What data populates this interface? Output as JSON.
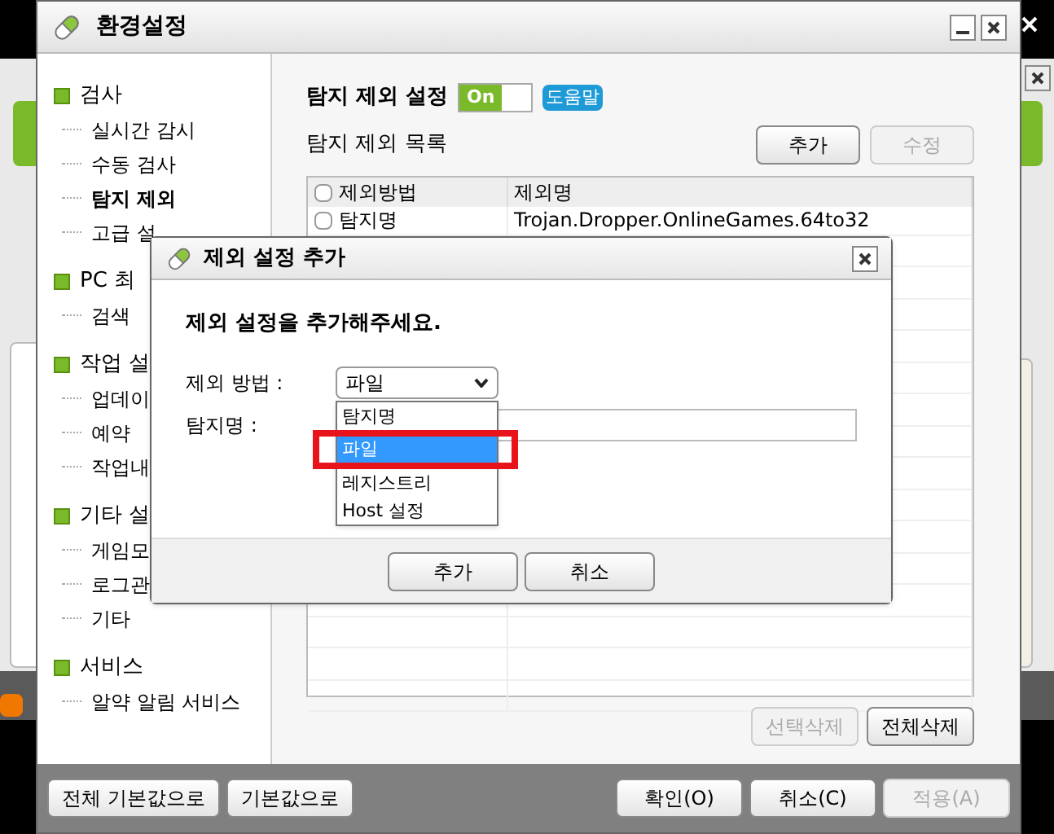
{
  "window": {
    "title": "환경설정"
  },
  "sidebar": {
    "groups": [
      {
        "label": "검사",
        "children": [
          {
            "label": "실시간 감시",
            "selected": false
          },
          {
            "label": "수동 검사",
            "selected": false
          },
          {
            "label": "탐지 제외",
            "selected": true
          },
          {
            "label": "고급 설",
            "selected": false
          }
        ]
      },
      {
        "label": "PC 최",
        "children": [
          {
            "label": "검색",
            "selected": false
          }
        ]
      },
      {
        "label": "작업 설",
        "children": [
          {
            "label": "업데이",
            "selected": false
          },
          {
            "label": "예약",
            "selected": false
          },
          {
            "label": "작업내",
            "selected": false
          }
        ]
      },
      {
        "label": "기타 설",
        "children": [
          {
            "label": "게임모",
            "selected": false
          },
          {
            "label": "로그관",
            "selected": false
          },
          {
            "label": "기타",
            "selected": false
          }
        ]
      },
      {
        "label": "서비스",
        "children": [
          {
            "label": "알약 알림 서비스",
            "selected": false
          }
        ]
      }
    ]
  },
  "content": {
    "title": "탐지 제외 설정",
    "toggle": {
      "label": "On",
      "on": true
    },
    "help": "도움말",
    "list_title": "탐지 제외 목록",
    "list_buttons": [
      {
        "label": "추가",
        "disabled": false
      },
      {
        "label": "수정",
        "disabled": true
      }
    ],
    "table": {
      "all_checked": false,
      "columns": [
        "제외방법",
        "제외명"
      ],
      "rows": [
        {
          "checked": false,
          "cells": [
            "탐지명",
            "Trojan.Dropper.OnlineGames.64to32"
          ]
        }
      ]
    },
    "bottom_buttons": [
      {
        "label": "선택삭제",
        "disabled": true
      },
      {
        "label": "전체삭제",
        "disabled": false
      }
    ]
  },
  "footer": {
    "left_buttons": [
      {
        "label": "전체 기본값으로",
        "disabled": false
      },
      {
        "label": "기본값으로",
        "disabled": false
      }
    ],
    "right_buttons": [
      {
        "label": "확인(O)",
        "disabled": false
      },
      {
        "label": "취소(C)",
        "disabled": false
      },
      {
        "label": "적용(A)",
        "disabled": true
      }
    ]
  },
  "dialog": {
    "title": "제외 설정 추가",
    "message": "제외 설정을 추가해주세요.",
    "method_label": "제외 방법 :",
    "method_value": "파일",
    "options": [
      {
        "label": "탐지명",
        "selected": false
      },
      {
        "label": "파일",
        "selected": true
      },
      {
        "label": "레지스트리",
        "selected": false
      },
      {
        "label": "Host 설정",
        "selected": false
      }
    ],
    "name_label": "탐지명 :",
    "buttons": [
      "추가",
      "취소"
    ]
  }
}
